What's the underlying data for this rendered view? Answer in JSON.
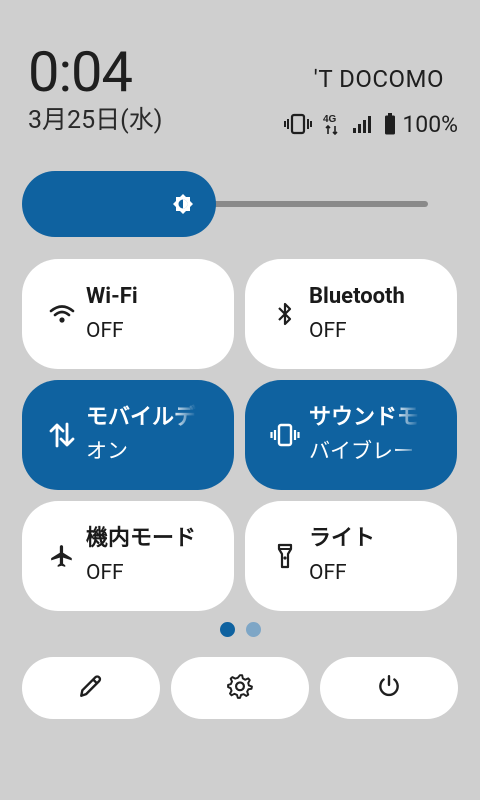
{
  "status": {
    "time": "0:04",
    "date": "3月25日(水)",
    "carrier": "'T DOCOMO",
    "network": "4G",
    "battery": "100%"
  },
  "brightness": {
    "level_fraction": 0.45,
    "icon": "brightness-icon"
  },
  "tiles": [
    {
      "title": "Wi-Fi",
      "status": "OFF",
      "icon": "wifi-icon",
      "active": false
    },
    {
      "title": "Bluetooth",
      "status": "OFF",
      "icon": "bluetooth-icon",
      "active": false
    },
    {
      "title": "モバイルデ",
      "status": "オン",
      "icon": "mobile-data-icon",
      "active": true
    },
    {
      "title": "サウンドモ",
      "status": "バイブレー",
      "icon": "vibrate-icon",
      "active": true
    },
    {
      "title": "機内モード",
      "status": "OFF",
      "icon": "airplane-icon",
      "active": false
    },
    {
      "title": "ライト",
      "status": "OFF",
      "icon": "flashlight-icon",
      "active": false
    }
  ],
  "pager": {
    "current": 1,
    "total": 2
  },
  "actions": [
    {
      "icon": "edit-pencil-icon"
    },
    {
      "icon": "settings-gear-icon"
    },
    {
      "icon": "power-icon"
    }
  ],
  "colors": {
    "accent": "#0f62a0",
    "background": "#cfcfcf",
    "tile": "#ffffff"
  }
}
